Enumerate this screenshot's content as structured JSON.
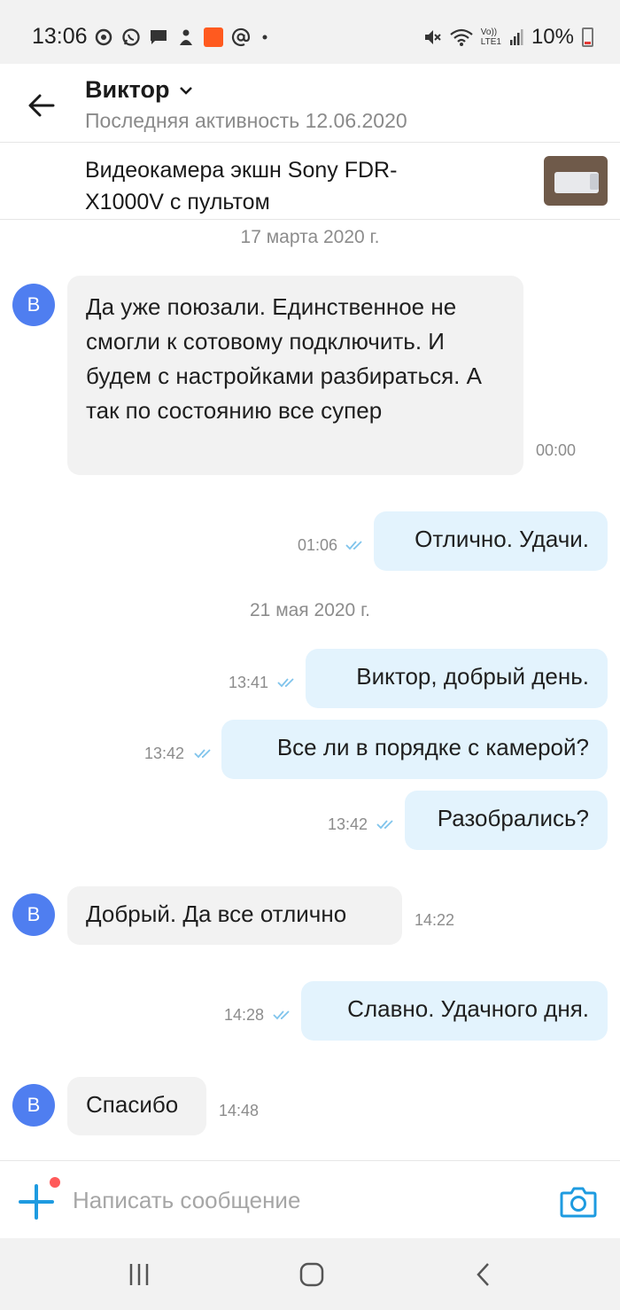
{
  "status_bar": {
    "time": "13:06",
    "battery": "10%",
    "network": "LTE1",
    "volte": "Vo))",
    "left_icons": [
      "sync-icon",
      "whatsapp-icon",
      "message-icon",
      "notification-icon",
      "aliexpress-icon",
      "at-icon",
      "dot-icon"
    ],
    "right_icons": [
      "mute-icon",
      "wifi-icon",
      "lte-icon",
      "signal-icon",
      "battery-icon"
    ]
  },
  "header": {
    "contact_name": "Виктор",
    "last_active": "Последняя активность 12.06.2020"
  },
  "product": {
    "title": "Видеокамера экшн Sony FDR-X1000V с пультом"
  },
  "avatar_letter": "В",
  "messages": [
    {
      "type": "date",
      "text": "17 марта 2020 г."
    },
    {
      "type": "incoming",
      "text": "Да уже поюзали. Единственное не смогли к сотовому подключить. И будем с настройками разбираться. А так по состоянию все супер",
      "time": "00:00"
    },
    {
      "type": "outgoing",
      "text": "Отлично. Удачи.",
      "time": "01:06"
    },
    {
      "type": "date",
      "text": "21 мая 2020 г."
    },
    {
      "type": "outgoing",
      "text": "Виктор, добрый день.",
      "time": "13:41"
    },
    {
      "type": "outgoing",
      "text": "Все ли в порядке с камерой?",
      "time": "13:42"
    },
    {
      "type": "outgoing",
      "text": "Разобрались?",
      "time": "13:42"
    },
    {
      "type": "incoming",
      "text": "Добрый. Да все отлично",
      "time": "14:22"
    },
    {
      "type": "outgoing",
      "text": "Славно. Удачного дня.",
      "time": "14:28"
    },
    {
      "type": "incoming",
      "text": "Спасибо",
      "time": "14:48"
    }
  ],
  "composer": {
    "placeholder": "Написать сообщение"
  },
  "colors": {
    "accent": "#1e9be0",
    "avatar": "#4f7ef0",
    "outgoing_bubble": "#e3f3fd",
    "incoming_bubble": "#f2f2f2",
    "read_check": "#80c4ec",
    "notification_dot": "#ff5a5a"
  }
}
